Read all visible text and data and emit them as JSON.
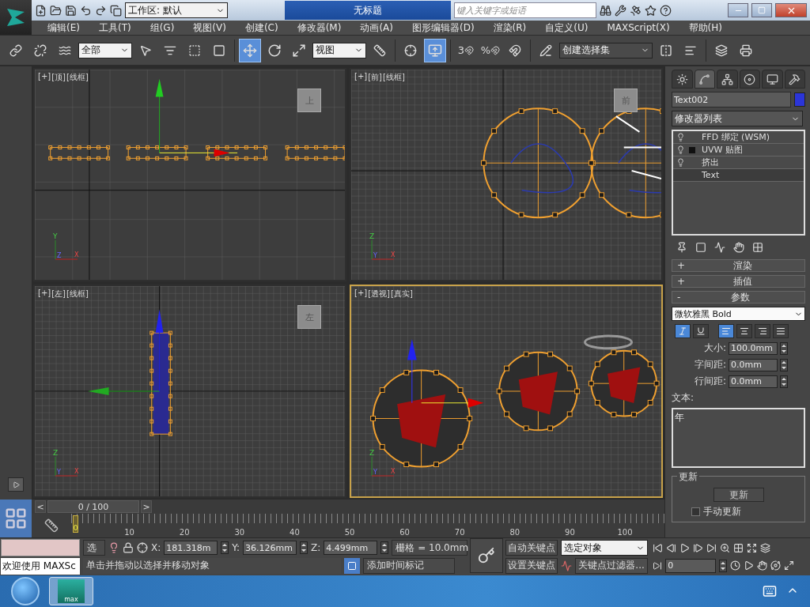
{
  "title_bar": {
    "workspace": "工作区: 默认",
    "title": "无标题",
    "search": {
      "placeholder": "键入关键字或短语"
    }
  },
  "menu": [
    "编辑(E)",
    "工具(T)",
    "组(G)",
    "视图(V)",
    "创建(C)",
    "修改器(M)",
    "动画(A)",
    "图形编辑器(D)",
    "渲染(R)",
    "自定义(U)",
    "MAXScript(X)",
    "帮助(H)"
  ],
  "toolbar": {
    "selection_filter": "全部",
    "reference_coord": "视图",
    "selection_set": "创建选择集",
    "transform_tools": [
      {
        "kind": "move",
        "selected": true
      },
      {
        "kind": "rotate",
        "selected": false
      },
      {
        "kind": "scale",
        "selected": false
      }
    ],
    "pivot_selected": true,
    "snaps": [
      "3",
      "%"
    ]
  },
  "viewports": [
    {
      "kind": "top",
      "labels": [
        "[+]",
        "[顶]",
        "[线框]"
      ],
      "active": false,
      "cube_label": "上",
      "tripod": [
        "Y",
        "Z",
        "X"
      ]
    },
    {
      "kind": "front",
      "labels": [
        "[+]",
        "[前]",
        "[线框]"
      ],
      "active": false,
      "cube_label": "前",
      "tripod": [
        "Z",
        "Y",
        "X"
      ]
    },
    {
      "kind": "left",
      "labels": [
        "[+]",
        "[左]",
        "[线框]"
      ],
      "active": false,
      "cube_label": "左",
      "tripod": [
        "Z",
        "Y",
        "X"
      ]
    },
    {
      "kind": "perspective",
      "labels": [
        "[+]",
        "[透视]",
        "[真实]"
      ],
      "active": true,
      "tripod": [
        "Z",
        "Y",
        "X"
      ]
    }
  ],
  "command_panel": {
    "tabs": [
      {
        "selected": false
      },
      {
        "selected": true
      },
      {
        "selected": false
      },
      {
        "selected": false
      },
      {
        "selected": false
      },
      {
        "selected": false
      }
    ],
    "object_name": "Text002",
    "modifier_list": "修改器列表",
    "stack": [
      {
        "label": "FFD 绑定 (WSM)",
        "on": true,
        "expander": false,
        "selected": false
      },
      {
        "label": "UVW 贴图",
        "on": true,
        "expander": true,
        "selected": false
      },
      {
        "label": "挤出",
        "on": true,
        "expander": false,
        "selected": false
      },
      {
        "label": "Text",
        "on": false,
        "expander": false,
        "selected": true
      }
    ],
    "rollouts": [
      {
        "sign": "+",
        "label": "渲染"
      },
      {
        "sign": "+",
        "label": "插值"
      },
      {
        "sign": "-",
        "label": "参数"
      }
    ],
    "parameters": {
      "font": "微软雅黑 Bold",
      "styles": [
        {
          "kind": "italic",
          "selected": true
        },
        {
          "kind": "underline",
          "selected": false
        }
      ],
      "alignment": [
        {
          "kind": "left",
          "selected": true
        },
        {
          "kind": "center",
          "selected": false
        },
        {
          "kind": "right",
          "selected": false
        },
        {
          "kind": "justify",
          "selected": false
        }
      ],
      "fields": [
        {
          "label": "大小:",
          "value": "100.0mm"
        },
        {
          "label": "字间距:",
          "value": "0.0mm"
        },
        {
          "label": "行间距:",
          "value": "0.0mm"
        }
      ],
      "text_label": "文本:",
      "text": "年",
      "update_group": "更新",
      "update_button": "更新",
      "manual_update": {
        "label": "手动更新",
        "checked": false
      }
    }
  },
  "timeline": {
    "prev": "<",
    "position": "0 / 100",
    "level": 0,
    "next": ">",
    "frame_marker": "0",
    "ruler": [
      "10",
      "20",
      "30",
      "40",
      "50",
      "60",
      "70",
      "80",
      "90",
      "100"
    ]
  },
  "status": {
    "listener": "欢迎使用 MAXSc",
    "selection": "选",
    "coords": [
      {
        "axis": "X:",
        "value": "181.318m"
      },
      {
        "axis": "Y:",
        "value": "36.126mm"
      },
      {
        "axis": "Z:",
        "value": "4.499mm"
      }
    ],
    "grid": "栅格 = 10.0mm",
    "prompt": "单击并拖动以选择并移动对象",
    "time_tag": "添加时间标记",
    "auto_key": "自动关键点",
    "set_key": "设置关键点",
    "key_mode": "选定对象",
    "key_filters": "关键点过滤器...",
    "frame": "0"
  },
  "taskbar": {
    "app_label": "max"
  }
}
